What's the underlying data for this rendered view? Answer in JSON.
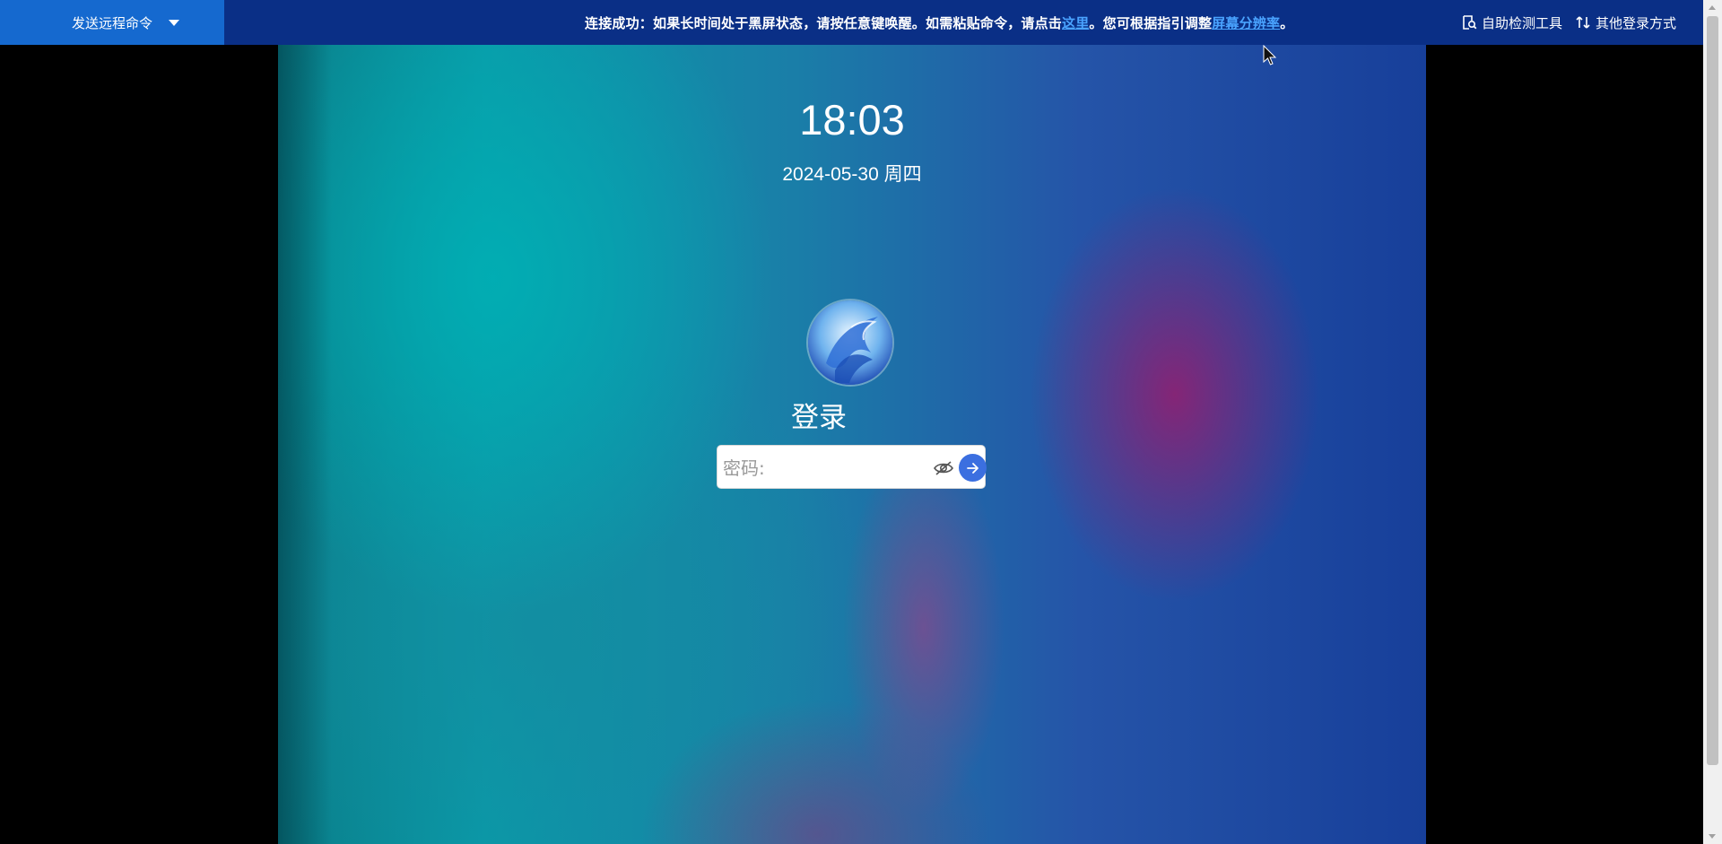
{
  "toolbar": {
    "send_command_label": "发送远程命令",
    "notice": {
      "part1": "连接成功：如果长时间处于黑屏状态，请按任意键唤醒。如需粘贴命令，请点击",
      "link1": "这里",
      "part2": "。您可根据指引调整",
      "link2": "屏幕分辨率",
      "part3": "。"
    },
    "tools": [
      {
        "icon": "self-check-icon",
        "label": "自助检测工具"
      },
      {
        "icon": "switch-login-icon",
        "label": "其他登录方式"
      }
    ]
  },
  "lockscreen": {
    "time": "18:03",
    "date": "2024-05-30 周四",
    "title": "登录",
    "password_placeholder": "密码:"
  },
  "colors": {
    "toolbar_bg": "#0a2f86",
    "send_command_bg": "#1569cf",
    "link": "#4aa3ff",
    "submit_button": "#3b6fe0"
  }
}
